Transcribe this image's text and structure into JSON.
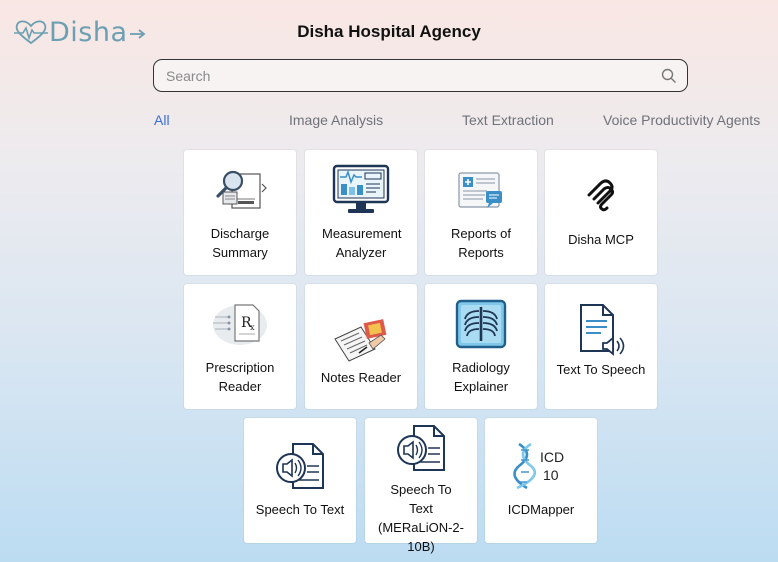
{
  "header": {
    "logo_text": "Disha",
    "title": "Disha Hospital Agency"
  },
  "search": {
    "placeholder": "Search",
    "value": ""
  },
  "tabs": [
    {
      "label": "All",
      "active": true
    },
    {
      "label": "Image Analysis",
      "active": false
    },
    {
      "label": "Text Extraction",
      "active": false
    },
    {
      "label": "Voice Productivity Agents",
      "active": false
    }
  ],
  "cards": [
    {
      "label": "Discharge Summary",
      "icon": "magnifier-document-icon"
    },
    {
      "label": "Measurement Analyzer",
      "icon": "monitor-chart-icon"
    },
    {
      "label": "Reports of Reports",
      "icon": "medical-report-icon"
    },
    {
      "label": "Disha MCP",
      "icon": "mcp-logo-icon"
    },
    {
      "label": "Prescription Reader",
      "icon": "prescription-rx-icon"
    },
    {
      "label": "Notes Reader",
      "icon": "notes-writing-icon"
    },
    {
      "label": "Radiology Explainer",
      "icon": "xray-ribcage-icon"
    },
    {
      "label": "Text To Speech",
      "icon": "document-speaker-icon"
    },
    {
      "label": "Speech To Text",
      "icon": "speaker-document-icon"
    },
    {
      "label": "Speech To Text (MERaLiON-2-10B)",
      "icon": "speaker-document-icon"
    },
    {
      "label": "ICDMapper",
      "icon": "icd10-dna-icon"
    }
  ],
  "icd_badge": {
    "line1": "ICD",
    "line2": "10"
  },
  "colors": {
    "logo": "#6c9fb1",
    "active_tab": "#3a6fd6",
    "inactive_tab": "#6f7279",
    "icon_navy": "#1f3555",
    "icon_blue": "#3b8fc7"
  }
}
